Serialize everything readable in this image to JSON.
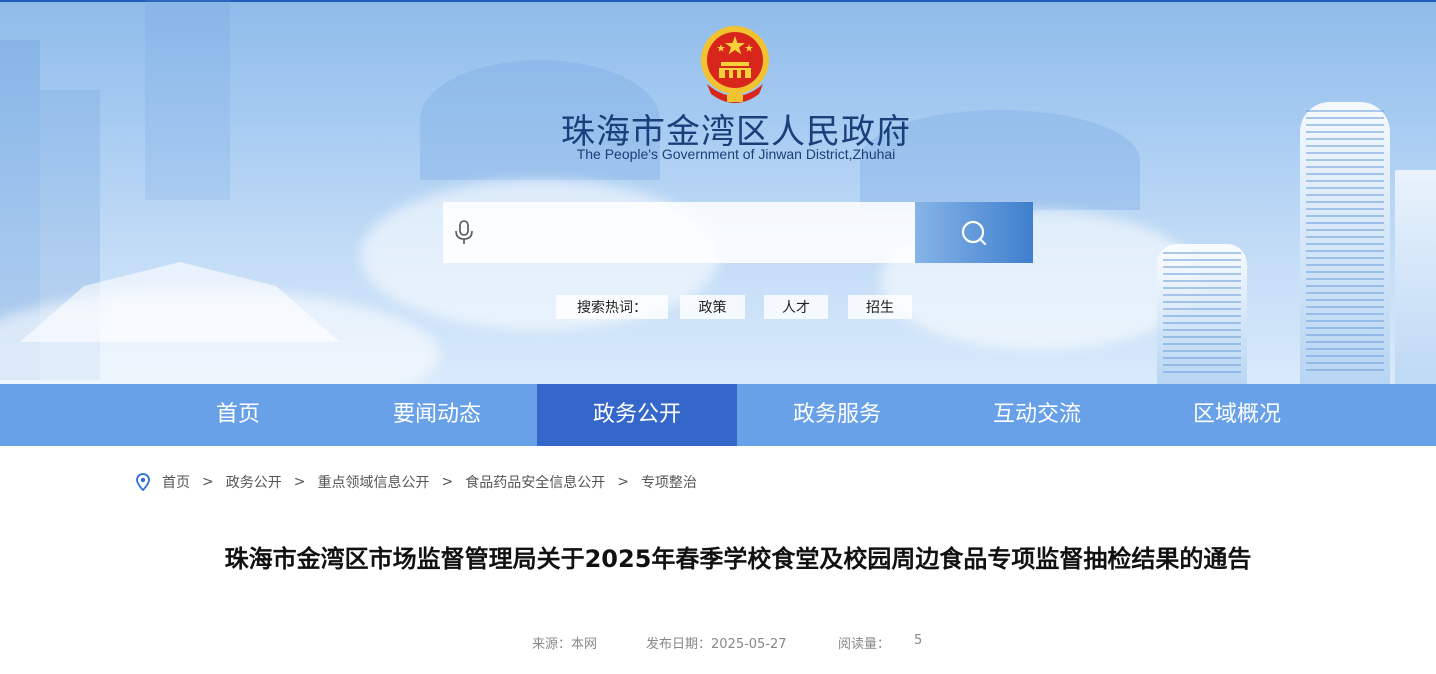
{
  "header": {
    "title": "珠海市金湾区人民政府",
    "subtitle": "The People's Government of Jinwan District,Zhuhai"
  },
  "search": {
    "placeholder": "",
    "hot_label": "搜索热词：",
    "hot_keywords": [
      "政策",
      "人才",
      "招生"
    ]
  },
  "nav": {
    "items": [
      "首页",
      "要闻动态",
      "政务公开",
      "政务服务",
      "互动交流",
      "区域概况"
    ],
    "active": "政务公开"
  },
  "breadcrumb": [
    "首页",
    "政务公开",
    "重点领域信息公开",
    "食品药品安全信息公开",
    "专项整治"
  ],
  "breadcrumb_separator": ">",
  "article": {
    "title": "珠海市金湾区市场监督管理局关于2025年春季学校食堂及校园周边食品专项监督抽检结果的通告",
    "source": "来源：本网",
    "date": "发布日期：2025-05-27",
    "views_label": "阅读量：",
    "views": "5"
  },
  "colors": {
    "nav_bg": "#68a1e8",
    "nav_active": "#3467c9",
    "title_blue": "#1a3f7a"
  },
  "icons": {
    "emblem": "national-emblem-icon",
    "mic": "microphone-icon",
    "search": "search-icon",
    "location": "location-pin-icon"
  }
}
